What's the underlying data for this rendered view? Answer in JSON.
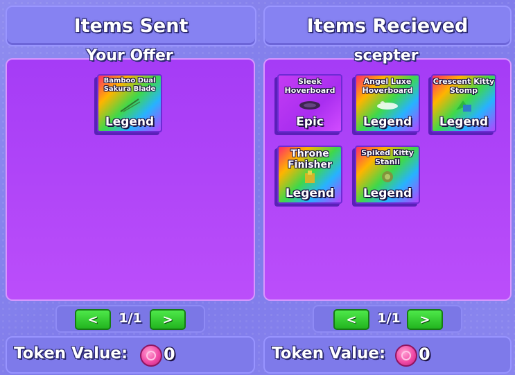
{
  "left": {
    "header": "Items Sent",
    "panel_title": "Your Offer",
    "items": [
      {
        "name": "Bamboo Dual Sakura Blade",
        "rarity": "Legend",
        "icon": "sword-icon"
      }
    ],
    "pager": {
      "prev": "<",
      "page": "1/1",
      "next": ">"
    },
    "token": {
      "label": "Token Value:",
      "value": "0",
      "icon": "token-coin-icon"
    }
  },
  "right": {
    "header": "Items Recieved",
    "panel_title": "scepter",
    "items": [
      {
        "name": "Sleek Hoverboard",
        "rarity": "Epic",
        "icon": "hoverboard-icon"
      },
      {
        "name": "Angel Luxe Hoverboard",
        "rarity": "Legend",
        "icon": "hoverboard-icon"
      },
      {
        "name": "Crescent Kitty Stomp",
        "rarity": "Legend",
        "icon": "emote-icon"
      },
      {
        "name": "Throne Finisher",
        "rarity": "Legend",
        "icon": "throne-icon"
      },
      {
        "name": "Spiked Kitty Stanli",
        "rarity": "Legend",
        "icon": "weapon-icon"
      }
    ],
    "pager": {
      "prev": "<",
      "page": "1/1",
      "next": ">"
    },
    "token": {
      "label": "Token Value:",
      "value": "0",
      "icon": "token-coin-icon"
    }
  },
  "colors": {
    "background": "#8a86ef",
    "panel": "#b547f8",
    "nav_button": "#2fc82b",
    "token": "#f04aa6"
  }
}
